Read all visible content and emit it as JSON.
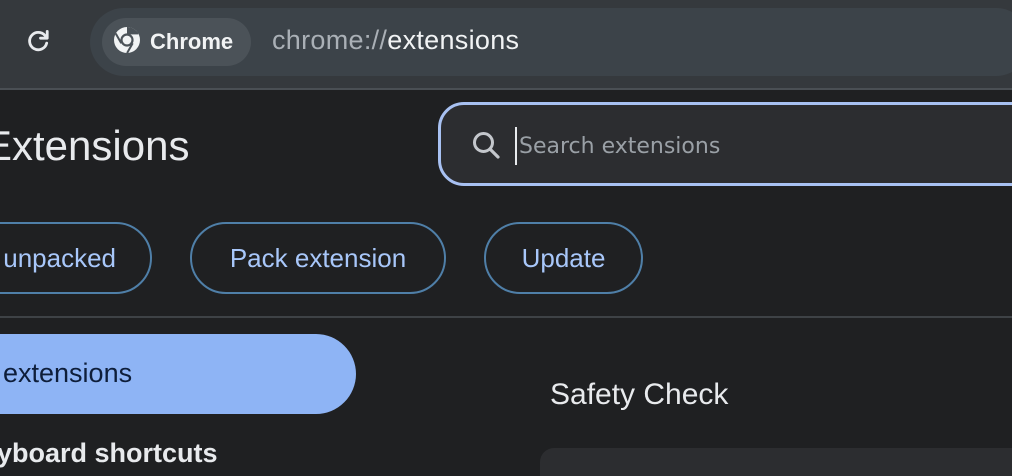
{
  "toolbar": {
    "reload_icon": "reload-icon",
    "site_chip": {
      "icon": "chrome-icon",
      "label": "Chrome"
    },
    "url": {
      "scheme": "chrome://",
      "host": "extensions"
    }
  },
  "header": {
    "title": "Extensions",
    "search": {
      "icon": "search-icon",
      "placeholder": "Search extensions",
      "value": ""
    }
  },
  "actions": {
    "load_unpacked": "unpacked",
    "pack_extension": "Pack extension",
    "update": "Update"
  },
  "sidebar": {
    "items": [
      {
        "label": "y extensions",
        "active": true
      },
      {
        "label": "eyboard shortcuts",
        "active": false
      }
    ]
  },
  "main": {
    "safety_check_title": "Safety Check"
  },
  "colors": {
    "accent": "#a8c7fa",
    "active_nav": "#8eb4f5",
    "background": "#1f2022",
    "toolbar": "#35393d"
  }
}
